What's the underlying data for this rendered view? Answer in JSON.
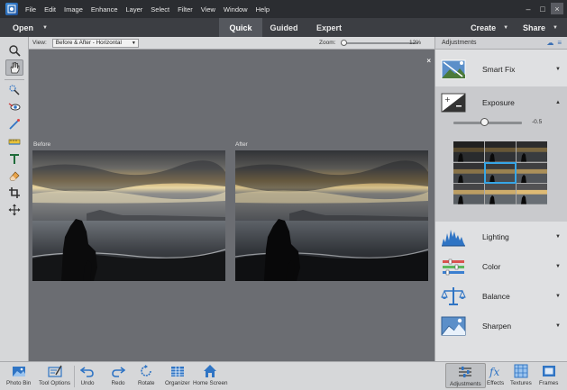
{
  "menu": {
    "items": [
      "File",
      "Edit",
      "Image",
      "Enhance",
      "Layer",
      "Select",
      "Filter",
      "View",
      "Window",
      "Help"
    ]
  },
  "window_controls": {
    "minimize": "–",
    "maximize": "□",
    "close": "×"
  },
  "mode_bar": {
    "open_label": "Open",
    "tabs": [
      {
        "label": "Quick",
        "active": true
      },
      {
        "label": "Guided",
        "active": false
      },
      {
        "label": "Expert",
        "active": false
      }
    ],
    "create_label": "Create",
    "share_label": "Share"
  },
  "view_bar": {
    "view_label": "View:",
    "view_value": "Before & After - Horizontal",
    "zoom_label": "Zoom:",
    "zoom_value": "12%",
    "zoom_level": 0.12
  },
  "canvas": {
    "before_label": "Before",
    "after_label": "After",
    "close_glyph": "×"
  },
  "panel": {
    "title": "Adjustments",
    "items": [
      {
        "label": "Smart Fix",
        "icon": "smart-fix-icon",
        "expanded": false
      },
      {
        "label": "Exposure",
        "icon": "exposure-icon",
        "expanded": true
      },
      {
        "label": "Lighting",
        "icon": "lighting-icon",
        "expanded": false
      },
      {
        "label": "Color",
        "icon": "color-icon",
        "expanded": false
      },
      {
        "label": "Balance",
        "icon": "balance-icon",
        "expanded": false
      },
      {
        "label": "Sharpen",
        "icon": "sharpen-icon",
        "expanded": false
      }
    ],
    "exposure_value": "-0.5",
    "exposure_slider_level": 0.45,
    "selected_thumbnail": 4
  },
  "bottom_bar": {
    "left": [
      {
        "label": "Photo Bin",
        "icon": "photo-bin-icon"
      },
      {
        "label": "Tool Options",
        "icon": "tool-options-icon"
      },
      {
        "label": "Undo",
        "icon": "undo-icon"
      },
      {
        "label": "Redo",
        "icon": "redo-icon"
      },
      {
        "label": "Rotate",
        "icon": "rotate-icon"
      },
      {
        "label": "Organizer",
        "icon": "organizer-icon"
      },
      {
        "label": "Home Screen",
        "icon": "home-icon"
      }
    ],
    "right": [
      {
        "label": "Adjustments",
        "icon": "adjustments-icon",
        "active": true
      },
      {
        "label": "Effects",
        "icon": "effects-icon",
        "active": false
      },
      {
        "label": "Textures",
        "icon": "textures-icon",
        "active": false
      },
      {
        "label": "Frames",
        "icon": "frames-icon",
        "active": false
      }
    ]
  },
  "colors": {
    "accent": "#37a6e6",
    "icon_blue": "#2f74c4"
  }
}
